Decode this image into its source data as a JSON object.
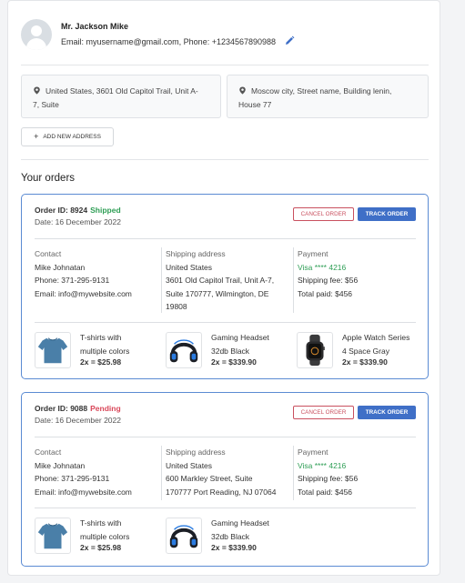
{
  "profile": {
    "name": "Mr. Jackson Mike",
    "info": "Email: myusername@gmail.com, Phone: +1234567890988"
  },
  "addresses": [
    {
      "line1": "United States, 3601 Old Capitol Trail, Unit A-",
      "line2": "7, Suite"
    },
    {
      "line1": "Moscow city, Street name, Building lenin,",
      "line2": "House 77"
    }
  ],
  "add_address_label": "ADD NEW ADDRESS",
  "orders_title": "Your orders",
  "orders": [
    {
      "id_label": "Order ID: 8924",
      "status": "Shipped",
      "status_color": "#2e9e55",
      "date": "Date: 16 December 2022",
      "cancel_label": "CANCEL ORDER",
      "track_label": "TRACK ORDER",
      "contact": {
        "label": "Contact",
        "name": "Mike Johnatan",
        "phone": "Phone: 371-295-9131",
        "email": "Email: info@mywebsite.com"
      },
      "shipping": {
        "label": "Shipping address",
        "lines": [
          "United States",
          "3601 Old Capitol Trail, Unit A-7,",
          "Suite 170777, Wilmington, DE",
          "19808"
        ]
      },
      "payment": {
        "label": "Payment",
        "card": "Visa **** 4216",
        "fee": "Shipping fee: $56",
        "total": "Total paid: $456"
      },
      "items": [
        {
          "icon": "tshirt-icon",
          "name1": "T-shirts with",
          "name2": "multiple colors",
          "price": "2x = $25.98"
        },
        {
          "icon": "headset-icon",
          "name1": "Gaming Headset",
          "name2": "32db Black",
          "price": "2x = $339.90"
        },
        {
          "icon": "watch-icon",
          "name1": "Apple Watch Series",
          "name2": "4 Space Gray",
          "price": "2x = $339.90"
        }
      ]
    },
    {
      "id_label": "Order ID: 9088",
      "status": "Pending",
      "status_color": "#d9485a",
      "date": "Date: 16 December 2022",
      "cancel_label": "CANCEL ORDER",
      "track_label": "TRACK ORDER",
      "contact": {
        "label": "Contact",
        "name": "Mike Johnatan",
        "phone": "Phone: 371-295-9131",
        "email": "Email: info@mywebsite.com"
      },
      "shipping": {
        "label": "Shipping address",
        "lines": [
          "United States",
          "600 Markley Street, Suite",
          "170777 Port Reading, NJ 07064"
        ]
      },
      "payment": {
        "label": "Payment",
        "card": "Visa **** 4216",
        "fee": "Shipping fee: $56",
        "total": "Total paid: $456"
      },
      "items": [
        {
          "icon": "tshirt-icon",
          "name1": "T-shirts with",
          "name2": "multiple colors",
          "price": "2x = $25.98"
        },
        {
          "icon": "headset-icon",
          "name1": "Gaming Headset",
          "name2": "32db Black",
          "price": "2x = $339.90"
        }
      ]
    }
  ]
}
